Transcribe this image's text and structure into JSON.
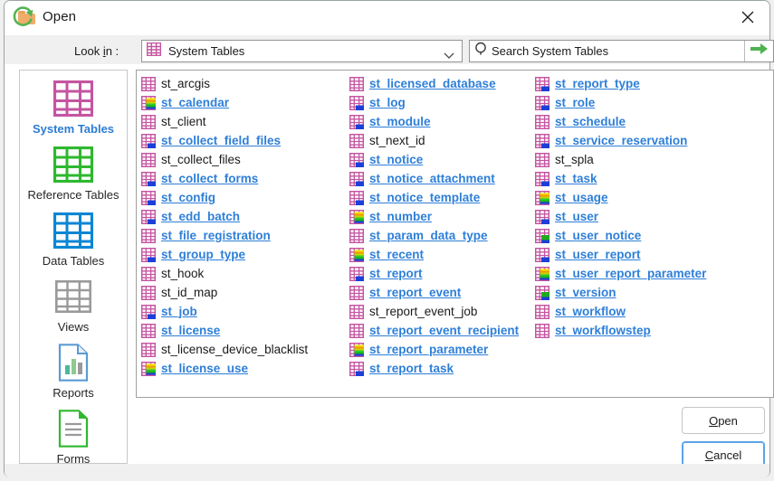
{
  "window": {
    "title": "Open",
    "folder_icon": "folder-icon",
    "close_icon": "close-icon"
  },
  "toolbar": {
    "refresh_icon": "refresh-icon",
    "lookin_label_pre": "Look ",
    "lookin_label_mnemonic": "i",
    "lookin_label_post": "n :",
    "location": {
      "icon": "table-icon-system",
      "value": "System Tables",
      "chevron_icon": "chevron-down-icon"
    },
    "search": {
      "icon": "search-icon",
      "placeholder": "Search System Tables",
      "value": "",
      "go_icon": "arrow-right-icon"
    }
  },
  "sidebar": {
    "items": [
      {
        "label": "System Tables",
        "icon": "table-icon-pink",
        "color": "#c455a0",
        "active": true
      },
      {
        "label": "Reference Tables",
        "icon": "table-icon-green",
        "color": "#2eb82e",
        "active": false
      },
      {
        "label": "Data Tables",
        "icon": "table-icon-blue",
        "color": "#0c86d4",
        "active": false
      },
      {
        "label": "Views",
        "icon": "table-icon-gray",
        "color": "#9a9a9a",
        "active": false
      },
      {
        "label": "Reports",
        "icon": "report-icon",
        "color": "#5b9bd5",
        "active": false
      },
      {
        "label": "Forms",
        "icon": "form-icon",
        "color": "#2eb82e",
        "active": false
      }
    ]
  },
  "file_list": {
    "columns": [
      {
        "items": [
          {
            "name": "st_arcgis",
            "link": false,
            "badge": "none"
          },
          {
            "name": "st_calendar",
            "link": true,
            "badge": "rainbow"
          },
          {
            "name": "st_client",
            "link": false,
            "badge": "none"
          },
          {
            "name": "st_collect_field_files",
            "link": true,
            "badge": "blue"
          },
          {
            "name": "st_collect_files",
            "link": false,
            "badge": "none"
          },
          {
            "name": "st_collect_forms",
            "link": true,
            "badge": "blue"
          },
          {
            "name": "st_config",
            "link": true,
            "badge": "blue"
          },
          {
            "name": "st_edd_batch",
            "link": true,
            "badge": "blue"
          },
          {
            "name": "st_file_registration",
            "link": true,
            "badge": "none"
          },
          {
            "name": "st_group_type",
            "link": true,
            "badge": "blue"
          },
          {
            "name": "st_hook",
            "link": false,
            "badge": "none"
          },
          {
            "name": "st_id_map",
            "link": false,
            "badge": "none"
          },
          {
            "name": "st_job",
            "link": true,
            "badge": "blue"
          },
          {
            "name": "st_license",
            "link": true,
            "badge": "none"
          },
          {
            "name": "st_license_device_blacklist",
            "link": false,
            "badge": "none"
          },
          {
            "name": "st_license_use",
            "link": true,
            "badge": "rainbow"
          }
        ]
      },
      {
        "items": [
          {
            "name": "st_licensed_database",
            "link": true,
            "badge": "none"
          },
          {
            "name": "st_log",
            "link": true,
            "badge": "blue"
          },
          {
            "name": "st_module",
            "link": true,
            "badge": "blue"
          },
          {
            "name": "st_next_id",
            "link": false,
            "badge": "none"
          },
          {
            "name": "st_notice",
            "link": true,
            "badge": "blue"
          },
          {
            "name": "st_notice_attachment",
            "link": true,
            "badge": "blue"
          },
          {
            "name": "st_notice_template",
            "link": true,
            "badge": "blue"
          },
          {
            "name": "st_number",
            "link": true,
            "badge": "rainbow"
          },
          {
            "name": "st_param_data_type",
            "link": true,
            "badge": "none"
          },
          {
            "name": "st_recent",
            "link": true,
            "badge": "rainbow"
          },
          {
            "name": "st_report",
            "link": true,
            "badge": "blue"
          },
          {
            "name": "st_report_event",
            "link": true,
            "badge": "none"
          },
          {
            "name": "st_report_event_job",
            "link": false,
            "badge": "none"
          },
          {
            "name": "st_report_event_recipient",
            "link": true,
            "badge": "none"
          },
          {
            "name": "st_report_parameter",
            "link": true,
            "badge": "rainbow"
          },
          {
            "name": "st_report_task",
            "link": true,
            "badge": "blue"
          }
        ]
      },
      {
        "items": [
          {
            "name": "st_report_type",
            "link": true,
            "badge": "blue"
          },
          {
            "name": "st_role",
            "link": true,
            "badge": "blue"
          },
          {
            "name": "st_schedule",
            "link": true,
            "badge": "none"
          },
          {
            "name": "st_service_reservation",
            "link": true,
            "badge": "blue"
          },
          {
            "name": "st_spla",
            "link": false,
            "badge": "none"
          },
          {
            "name": "st_task",
            "link": true,
            "badge": "blue"
          },
          {
            "name": "st_usage",
            "link": true,
            "badge": "rainbow"
          },
          {
            "name": "st_user",
            "link": true,
            "badge": "blue"
          },
          {
            "name": "st_user_notice",
            "link": true,
            "badge": "green"
          },
          {
            "name": "st_user_report",
            "link": true,
            "badge": "blue"
          },
          {
            "name": "st_user_report_parameter",
            "link": true,
            "badge": "rainbow"
          },
          {
            "name": "st_version",
            "link": true,
            "badge": "green"
          },
          {
            "name": "st_workflow",
            "link": true,
            "badge": "none"
          },
          {
            "name": "st_workflowstep",
            "link": true,
            "badge": "none"
          }
        ]
      }
    ]
  },
  "buttons": {
    "open": {
      "pre": "",
      "mnemonic": "O",
      "post": "pen",
      "focused": false
    },
    "cancel": {
      "pre": "",
      "mnemonic": "C",
      "post": "ancel",
      "focused": true
    }
  },
  "colors": {
    "accent_link": "#2e7fd8",
    "table_pink": "#c455a0",
    "table_green": "#2eb82e",
    "table_blue": "#0c86d4",
    "table_gray": "#9a9a9a",
    "go_arrow": "#4caf50",
    "refresh": "#4caf50"
  }
}
